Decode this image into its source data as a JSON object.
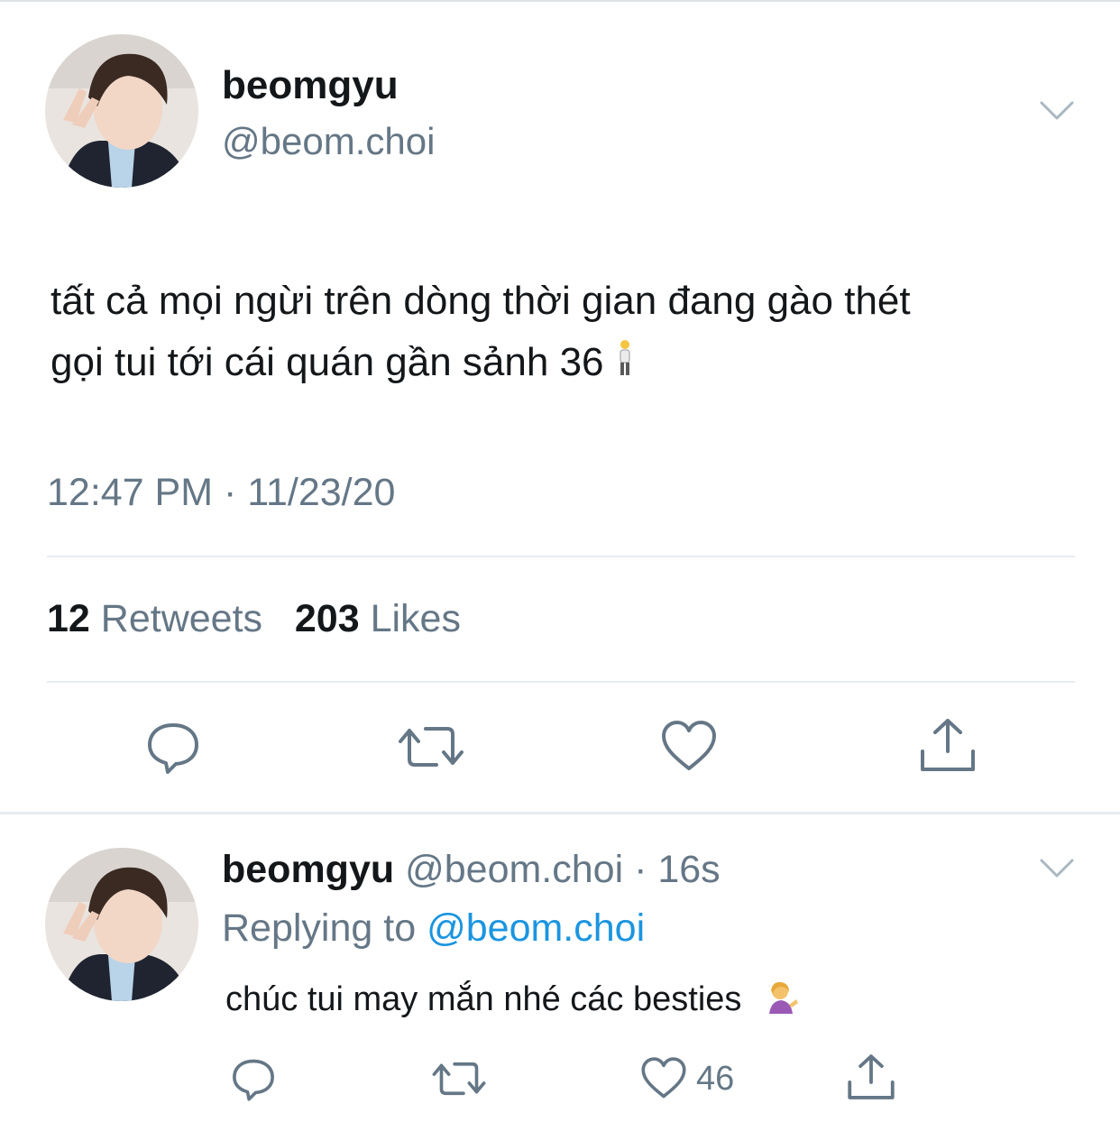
{
  "main_tweet": {
    "display_name": "beomgyu",
    "handle": "@beom.choi",
    "text_line1": "tất cả mọi ngừi trên dòng thời gian đang gào thét",
    "text_line2": "gọi tui tới cái quán gần sảnh 36",
    "timestamp": "12:47 PM · 11/23/20",
    "retweet_count": "12",
    "retweet_label": "Retweets",
    "like_count": "203",
    "like_label": "Likes"
  },
  "reply_tweet": {
    "display_name": "beomgyu",
    "handle_time": "@beom.choi · 16s",
    "replying_to_label": "Replying to",
    "replying_to_handle": "@beom.choi",
    "text": "chúc tui may mắn nhé các besties",
    "like_count": "46"
  },
  "icons": {
    "menu": "chevron-down-icon",
    "reply": "comment-icon",
    "retweet": "retweet-icon",
    "like": "heart-icon",
    "share": "share-icon"
  },
  "colors": {
    "text": "#14171a",
    "muted": "#657786",
    "link": "#1b95e0",
    "divider": "#e6ecf0"
  }
}
